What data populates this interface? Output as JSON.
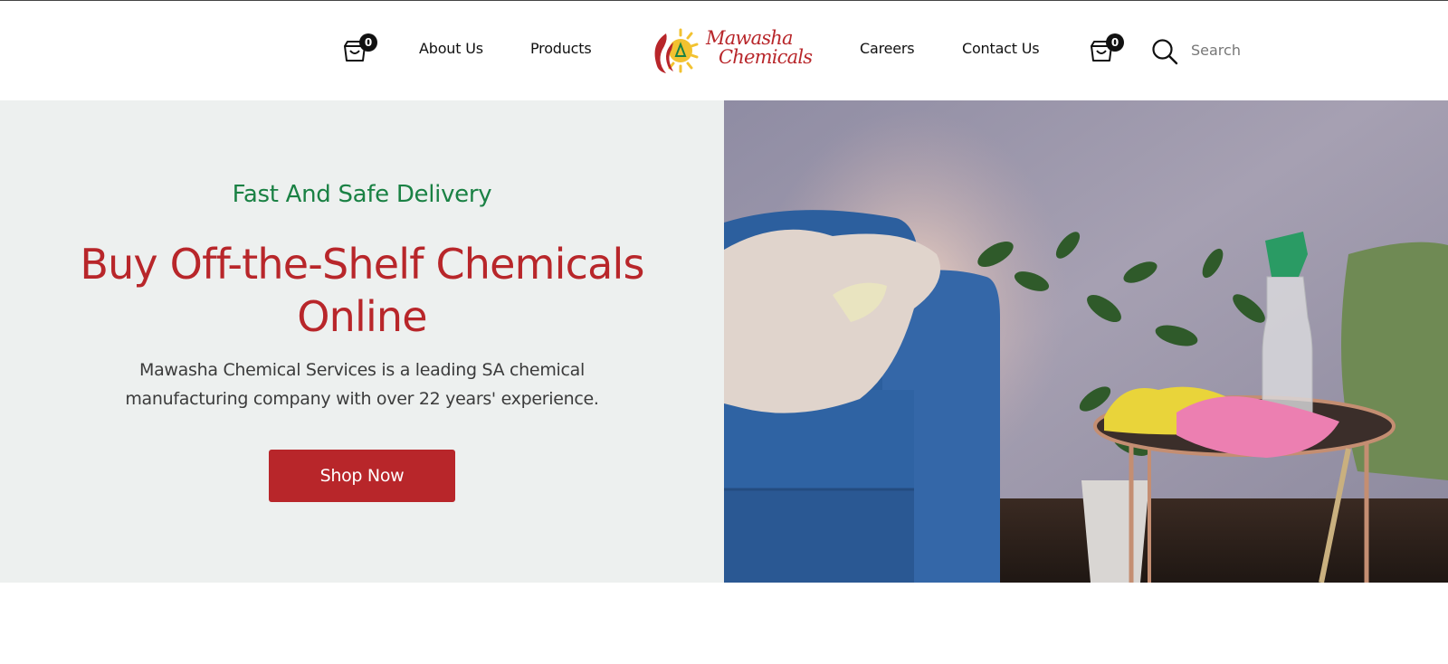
{
  "header": {
    "cart_left": {
      "count": "0",
      "icon": "shopping-bag-icon"
    },
    "nav_left": [
      {
        "label": "About Us"
      },
      {
        "label": "Products"
      }
    ],
    "logo": {
      "line1": "Mawasha",
      "line2": "Chemicals",
      "icon": "sun-flask-logo-icon"
    },
    "nav_right": [
      {
        "label": "Careers"
      },
      {
        "label": "Contact Us"
      }
    ],
    "cart_right": {
      "count": "0",
      "icon": "shopping-bag-icon"
    },
    "search": {
      "placeholder": "Search",
      "icon": "search-icon"
    }
  },
  "hero": {
    "eyebrow": "Fast And Safe Delivery",
    "headline": "Buy Off-the-Shelf Chemicals Online",
    "subtext": "Mawasha Chemical Services is a leading SA chemical manufacturing company with over 22 years' experience.",
    "cta_label": "Shop Now",
    "image": "photo of a blue sofa with a blanket, houseplant, and round side table holding a spray bottle, yellow rubber gloves and a pink cloth"
  },
  "colors": {
    "brand_red": "#b8262a",
    "accent_green": "#1a8144",
    "hero_bg": "#edf0ef",
    "logo_sun": "#f2c230"
  }
}
